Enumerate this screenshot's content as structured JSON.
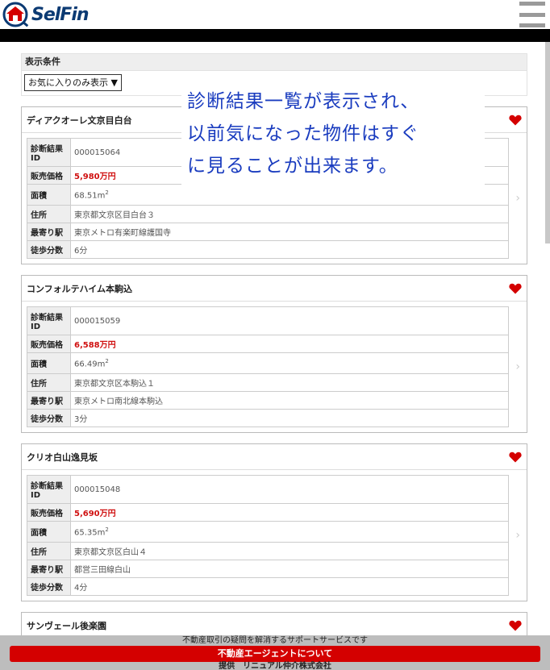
{
  "header": {
    "logo_text": "SelFin"
  },
  "conditions": {
    "title": "表示条件",
    "select_value": "お気に入りのみ表示 ▼"
  },
  "labels": {
    "id": "診断結果ID",
    "price": "販売価格",
    "area": "面積",
    "address": "住所",
    "station": "最寄り駅",
    "walk": "徒歩分数"
  },
  "properties": [
    {
      "name": "ディアクオーレ文京目白台",
      "id": "000015064",
      "price": "5,980万円",
      "area": "68.51m",
      "address": "東京都文京区目白台３",
      "station": "東京メトロ有楽町線護国寺",
      "walk": "6分"
    },
    {
      "name": "コンフォルテハイム本駒込",
      "id": "000015059",
      "price": "6,588万円",
      "area": "66.49m",
      "address": "東京都文京区本駒込１",
      "station": "東京メトロ南北線本駒込",
      "walk": "3分"
    },
    {
      "name": "クリオ白山逸見坂",
      "id": "000015048",
      "price": "5,690万円",
      "area": "65.35m",
      "address": "東京都文京区白山４",
      "station": "都営三田線白山",
      "walk": "4分"
    },
    {
      "name": "サンヴェール後楽園"
    }
  ],
  "area_sup": "2",
  "overlay": {
    "line1": "診断結果一覧が表示され、",
    "line2": "以前気になった物件はすぐ",
    "line3": "に見ることが出来ます。"
  },
  "footer": {
    "note": "不動産取引の疑問を解消するサポートサービスです",
    "button": "不動産エージェントについて",
    "provider": "提供　リニュアル仲介株式会社"
  },
  "colors": {
    "accent_red": "#d40000",
    "price_red": "#d01010",
    "logo_blue": "#0b3a73",
    "overlay_text": "#1a3cbf"
  },
  "icons": [
    "house-logo-icon",
    "hamburger-menu-icon",
    "heart-icon",
    "chevron-right-icon"
  ]
}
